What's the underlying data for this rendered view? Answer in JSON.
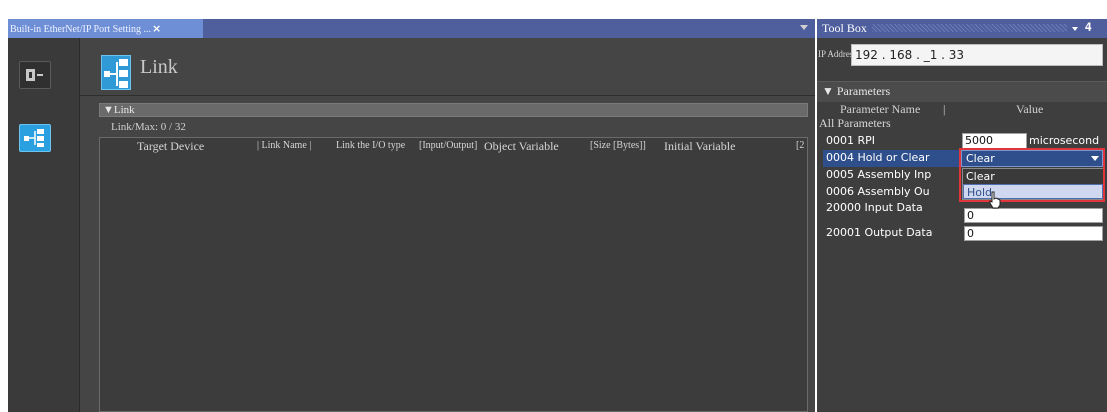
{
  "editor": {
    "tab_title": "Built-in EtherNet/IP Port Setting ...",
    "tab_close": "×",
    "header_title": "Link",
    "link_section": "▼Link",
    "link_max": "Link/Max: 0 / 32",
    "columns": [
      "Target Device",
      "| Link Name |",
      "Link the I/O type",
      "[Input/Output]",
      "Object Variable",
      "[Size [Bytes]]",
      "Initial Variable",
      "[2"
    ]
  },
  "toolbox": {
    "title": "Tool Box",
    "pin": "▾ 𝟒",
    "ip_label": "IP Address",
    "ip_value": "192 . 168 . _1 . 33",
    "parameters_label": "▼ Parameters",
    "col_name": "Parameter Name",
    "col_div": "|",
    "col_value": "Value",
    "all_params": "All Parameters",
    "rows": [
      {
        "name": "0001 RPI",
        "value": "5000",
        "unit": "microsecond"
      },
      {
        "name": "0004 Hold or Clear",
        "value": "Clear"
      },
      {
        "name": "0005 Assembly Inp",
        "value": ""
      },
      {
        "name": "0006 Assembly Ou",
        "value": ""
      },
      {
        "name": "20000 Input Data",
        "value": "0"
      },
      {
        "name": "20001 Output Data",
        "value": "0"
      }
    ],
    "dropdown_options": [
      "Clear",
      "Hold"
    ]
  }
}
